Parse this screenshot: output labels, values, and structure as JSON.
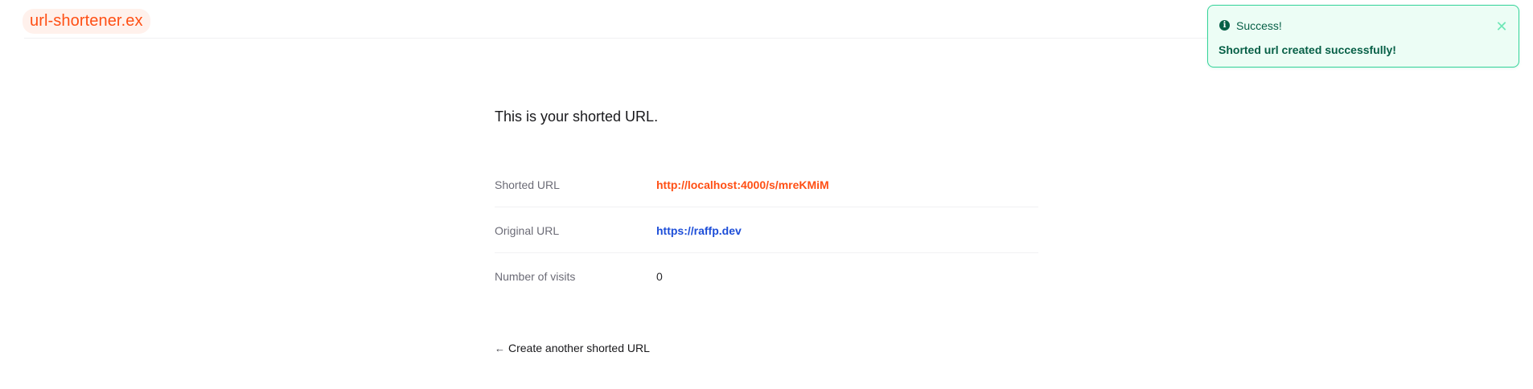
{
  "header": {
    "brand": "url-shortener.ex"
  },
  "main": {
    "title": "This is your shorted URL.",
    "details": [
      {
        "label": "Shorted URL",
        "value": "http://localhost:4000/s/mreKMiM"
      },
      {
        "label": "Original URL",
        "value": "https://raffp.dev"
      },
      {
        "label": "Number of visits",
        "value": "0"
      }
    ],
    "back_link": "Create another shorted URL"
  },
  "toast": {
    "title": "Success!",
    "message": "Shorted url created successfully!",
    "icon": "info-icon",
    "close_icon": "close-icon"
  },
  "colors": {
    "brand": "#ff4f14",
    "link_blue": "#1d4ed8",
    "success_text": "#065f46",
    "success_border": "#34d399",
    "success_bg": "#ecfdf5"
  }
}
